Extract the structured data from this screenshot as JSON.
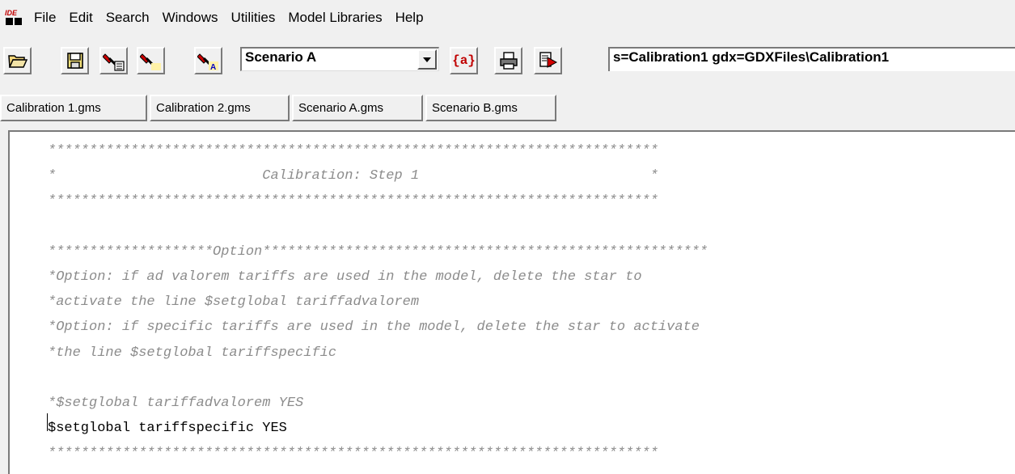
{
  "app": {
    "icon_text": "IDE"
  },
  "menu": [
    "File",
    "Edit",
    "Search",
    "Windows",
    "Utilities",
    "Model Libraries",
    "Help"
  ],
  "toolbar": {
    "scenario_value": "Scenario A",
    "param_value": "s=Calibration1 gdx=GDXFiles\\Calibration1",
    "model_attr_label": "{a}",
    "icons": [
      "open-folder-icon",
      "save-icon",
      "run-gams-icon",
      "run-icon",
      "run-with-options-icon",
      "model-attributes-icon",
      "print-icon",
      "stop-icon"
    ]
  },
  "tabs": [
    "Calibration 1.gms",
    "Calibration 2.gms",
    "Scenario A.gms",
    "Scenario B.gms"
  ],
  "editor": {
    "lines": [
      {
        "text": "**************************************************************************",
        "style": "comment"
      },
      {
        "text": "*                         Calibration: Step 1                            *",
        "style": "comment"
      },
      {
        "text": "**************************************************************************",
        "style": "comment"
      },
      {
        "text": "",
        "style": "comment"
      },
      {
        "text": "********************Option******************************************************",
        "style": "comment"
      },
      {
        "text": "*Option: if ad valorem tariffs are used in the model, delete the star to",
        "style": "comment"
      },
      {
        "text": "*activate the line $setglobal tariffadvalorem",
        "style": "comment"
      },
      {
        "text": "*Option: if specific tariffs are used in the model, delete the star to activate",
        "style": "comment"
      },
      {
        "text": "*the line $setglobal tariffspecific",
        "style": "comment"
      },
      {
        "text": "",
        "style": "comment"
      },
      {
        "text": "*$setglobal tariffadvalorem YES",
        "style": "comment"
      },
      {
        "text": "$setglobal tariffspecific YES",
        "style": "command"
      },
      {
        "text": "**************************************************************************",
        "style": "comment"
      }
    ]
  }
}
